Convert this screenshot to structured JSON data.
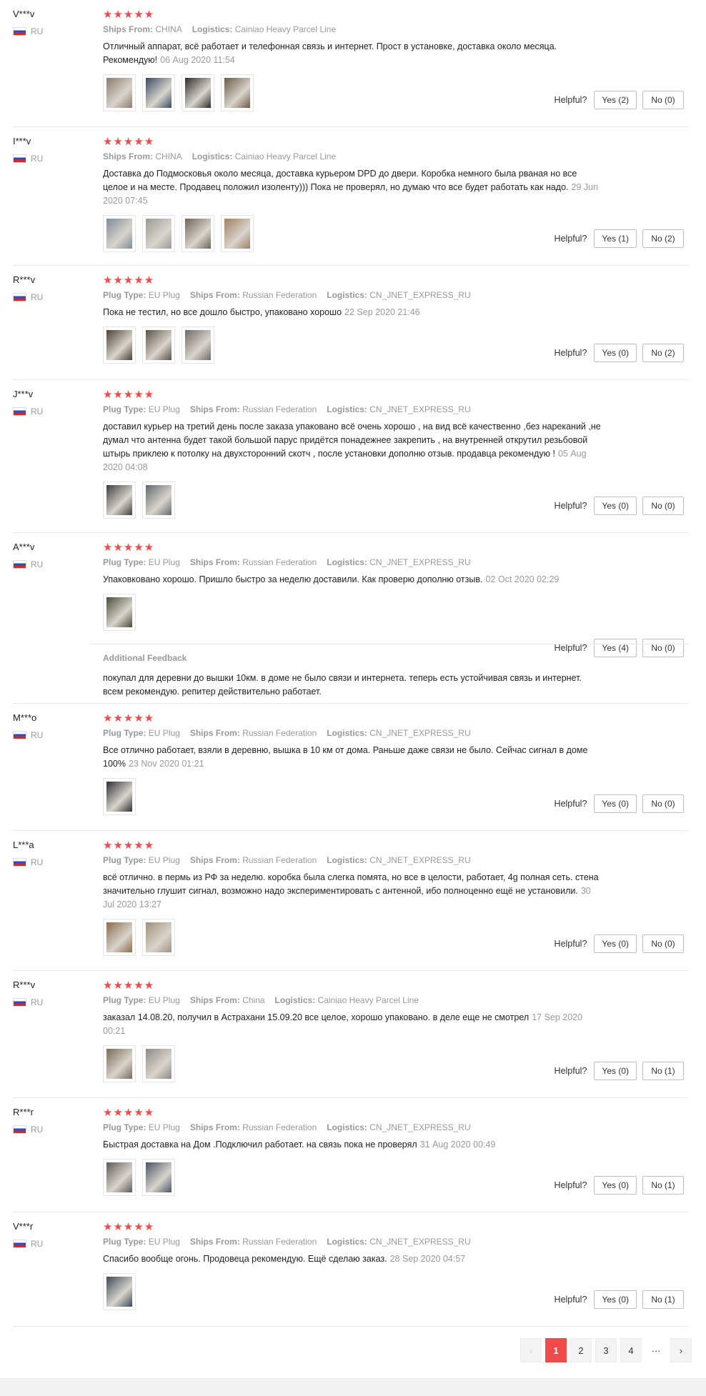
{
  "helpful_label": "Helpful?",
  "reviews": [
    {
      "author": "V***v",
      "country": "RU",
      "stars": "★★★★★",
      "plug_label": "",
      "plug_value": "",
      "ships_label": "Ships From:",
      "ships_value": "CHINA",
      "logistics_label": "Logistics:",
      "logistics_value": "Cainiao Heavy Parcel Line",
      "text": "Отличный аппарат, всё работает и телефонная связь и интернет. Прост в установке, доставка около месяца. Рекомендую!",
      "date": "06 Aug 2020 11:54",
      "thumbs": 4,
      "yes": "Yes (2)",
      "no": "No (0)"
    },
    {
      "author": "I***v",
      "country": "RU",
      "stars": "★★★★★",
      "plug_label": "",
      "plug_value": "",
      "ships_label": "Ships From:",
      "ships_value": "CHINA",
      "logistics_label": "Logistics:",
      "logistics_value": "Cainiao Heavy Parcel Line",
      "text": "Доставка до Подмосковья около месяца, доставка курьером DPD до двери. Коробка немного была рваная но все целое и на месте. Продавец положил изоленту))) Пока не проверял, но думаю что все будет работать как надо.",
      "date": "29 Jun 2020 07:45",
      "thumbs": 4,
      "yes": "Yes (1)",
      "no": "No (2)"
    },
    {
      "author": "R***v",
      "country": "RU",
      "stars": "★★★★★",
      "plug_label": "Plug Type:",
      "plug_value": "EU Plug",
      "ships_label": "Ships From:",
      "ships_value": "Russian Federation",
      "logistics_label": "Logistics:",
      "logistics_value": "CN_JNET_EXPRESS_RU",
      "text": "Пока не тестил, но все дошло быстро, упаковано хорошо",
      "date": "22 Sep 2020 21:46",
      "thumbs": 3,
      "yes": "Yes (0)",
      "no": "No (2)"
    },
    {
      "author": "J***v",
      "country": "RU",
      "stars": "★★★★★",
      "plug_label": "Plug Type:",
      "plug_value": "EU Plug",
      "ships_label": "Ships From:",
      "ships_value": "Russian Federation",
      "logistics_label": "Logistics:",
      "logistics_value": "CN_JNET_EXPRESS_RU",
      "text": "доставил курьер на третий день после заказа упаковано всё очень хорошо , на вид всё качественно ,без нареканий ,не думал что антенна будет такой большой парус придётся понадежнее закрепить , на внутренней открутил резьбовой штырь приклею к потолку на двухсторонний скотч , после установки дополню отзыв. продавца рекомендую !",
      "date": "05 Aug 2020 04:08",
      "thumbs": 2,
      "yes": "Yes (0)",
      "no": "No (0)"
    },
    {
      "author": "A***v",
      "country": "RU",
      "stars": "★★★★★",
      "plug_label": "Plug Type:",
      "plug_value": "EU Plug",
      "ships_label": "Ships From:",
      "ships_value": "Russian Federation",
      "logistics_label": "Logistics:",
      "logistics_value": "CN_JNET_EXPRESS_RU",
      "text": "Упаковковано хорошо. Пришло быстро за неделю доставили. Как проверю дополню отзыв.",
      "date": "02 Oct 2020 02:29",
      "thumbs": 1,
      "yes": "Yes (4)",
      "no": "No (0)",
      "additional_label": "Additional Feedback",
      "additional_text": "покупал для деревни до вышки 10км. в доме не было связи и интернета. теперь есть устойчивая связь и интернет. всем рекомендую. репитер действительно работает."
    },
    {
      "author": "M***o",
      "country": "RU",
      "stars": "★★★★★",
      "plug_label": "Plug Type:",
      "plug_value": "EU Plug",
      "ships_label": "Ships From:",
      "ships_value": "Russian Federation",
      "logistics_label": "Logistics:",
      "logistics_value": "CN_JNET_EXPRESS_RU",
      "text": "Все отлично работает, взяли в деревню, вышка в 10 км от дома. Раньше даже связи не было. Сейчас сигнал в доме 100%",
      "date": "23 Nov 2020 01:21",
      "thumbs": 1,
      "yes": "Yes (0)",
      "no": "No (0)"
    },
    {
      "author": "L***a",
      "country": "RU",
      "stars": "★★★★★",
      "plug_label": "Plug Type:",
      "plug_value": "EU Plug",
      "ships_label": "Ships From:",
      "ships_value": "Russian Federation",
      "logistics_label": "Logistics:",
      "logistics_value": "CN_JNET_EXPRESS_RU",
      "text": "всё отлично. в пермь из РФ за неделю. коробка была слегка помята, но все в целости, работает, 4g полная сеть. стена значительно глушит сигнал, возможно надо экспериментировать с антенной, ибо полноценно ещё не установили.",
      "date": "30 Jul 2020 13:27",
      "thumbs": 2,
      "yes": "Yes (0)",
      "no": "No (0)"
    },
    {
      "author": "R***v",
      "country": "RU",
      "stars": "★★★★★",
      "plug_label": "Plug Type:",
      "plug_value": "EU Plug",
      "ships_label": "Ships From:",
      "ships_value": "China",
      "logistics_label": "Logistics:",
      "logistics_value": "Cainiao Heavy Parcel Line",
      "text": "заказал 14.08.20, получил в Астрахани 15.09.20 все целое, хорошо упаковано. в деле еще не смотрел",
      "date": "17 Sep 2020 00:21",
      "thumbs": 2,
      "yes": "Yes (0)",
      "no": "No (1)"
    },
    {
      "author": "R***r",
      "country": "RU",
      "stars": "★★★★★",
      "plug_label": "Plug Type:",
      "plug_value": "EU Plug",
      "ships_label": "Ships From:",
      "ships_value": "Russian Federation",
      "logistics_label": "Logistics:",
      "logistics_value": "CN_JNET_EXPRESS_RU",
      "text": "Быстрая доставка на Дом .Подключил работает. на связь пока не проверял",
      "date": "31 Aug 2020 00:49",
      "thumbs": 2,
      "yes": "Yes (0)",
      "no": "No (1)"
    },
    {
      "author": "V***r",
      "country": "RU",
      "stars": "★★★★★",
      "plug_label": "Plug Type:",
      "plug_value": "EU Plug",
      "ships_label": "Ships From:",
      "ships_value": "Russian Federation",
      "logistics_label": "Logistics:",
      "logistics_value": "CN_JNET_EXPRESS_RU",
      "text": "Спасибо вообще огонь. Продовеца рекомендую. Ещё сделаю заказ.",
      "date": "28 Sep 2020 04:57",
      "thumbs": 1,
      "yes": "Yes (0)",
      "no": "No (1)"
    }
  ],
  "pagination": {
    "prev": "‹",
    "pages": [
      "1",
      "2",
      "3",
      "4"
    ],
    "ellipsis": "···",
    "next": "›",
    "current": "1"
  }
}
